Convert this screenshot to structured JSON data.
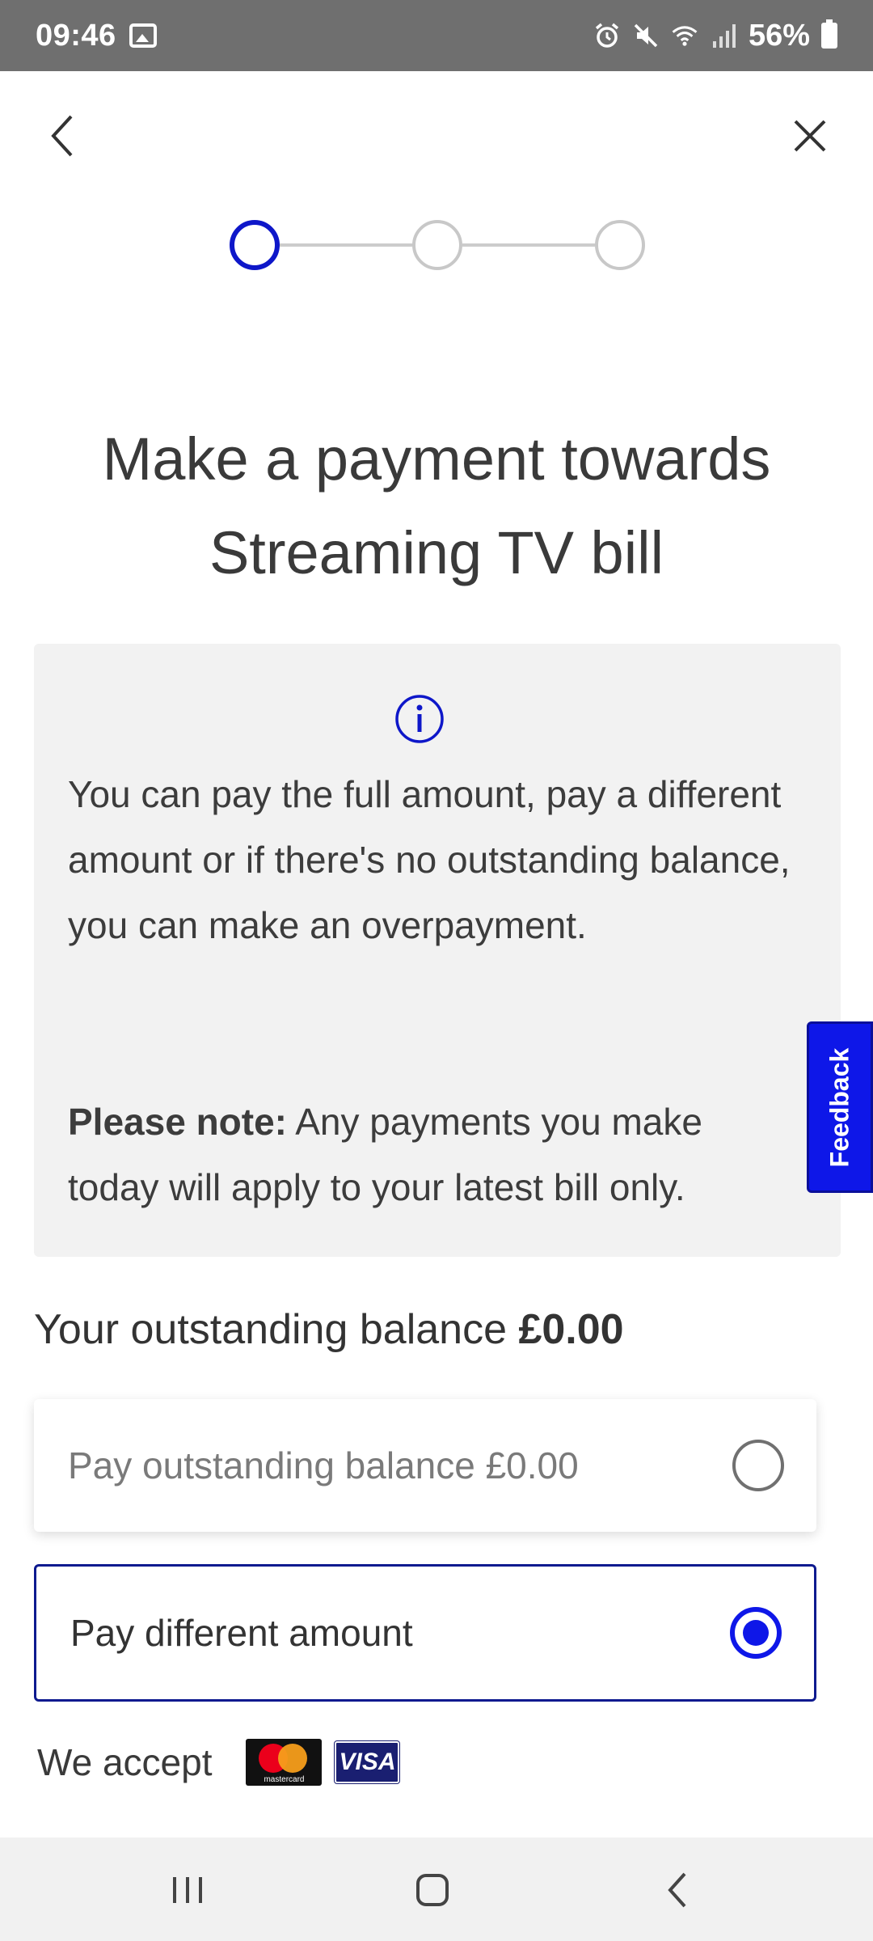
{
  "status_bar": {
    "time": "09:46",
    "battery_percent": "56%",
    "icons": [
      "gallery-icon",
      "alarm-icon",
      "mute-icon",
      "wifi-icon",
      "signal-icon",
      "battery-icon"
    ]
  },
  "nav": {
    "icons": [
      "back-chevron-icon",
      "close-icon"
    ]
  },
  "stepper": {
    "total_steps": 3,
    "current_step": 1
  },
  "page": {
    "title_line1": "Make a payment towards",
    "title_line2": "Streaming TV bill"
  },
  "info": {
    "icon": "info-icon",
    "text": "You can pay the full amount, pay a different amount or if there's no outstanding balance, you can make an overpayment.",
    "note_label": "Please note:",
    "note_text": " Any payments you make today will apply to your latest bill only."
  },
  "feedback": {
    "label": "Feedback"
  },
  "balance": {
    "label": "Your outstanding balance ",
    "amount": "£0.00"
  },
  "options": [
    {
      "label": "Pay outstanding balance £0.00",
      "selected": false
    },
    {
      "label": "Pay different amount",
      "selected": true
    }
  ],
  "accept": {
    "label": "We accept",
    "mastercard_text": "mastercard",
    "visa_text": "VISA"
  },
  "colors": {
    "accent": "#0e17e8",
    "status_bar": "#6f6f6f",
    "info_bg": "#f2f2f2"
  }
}
